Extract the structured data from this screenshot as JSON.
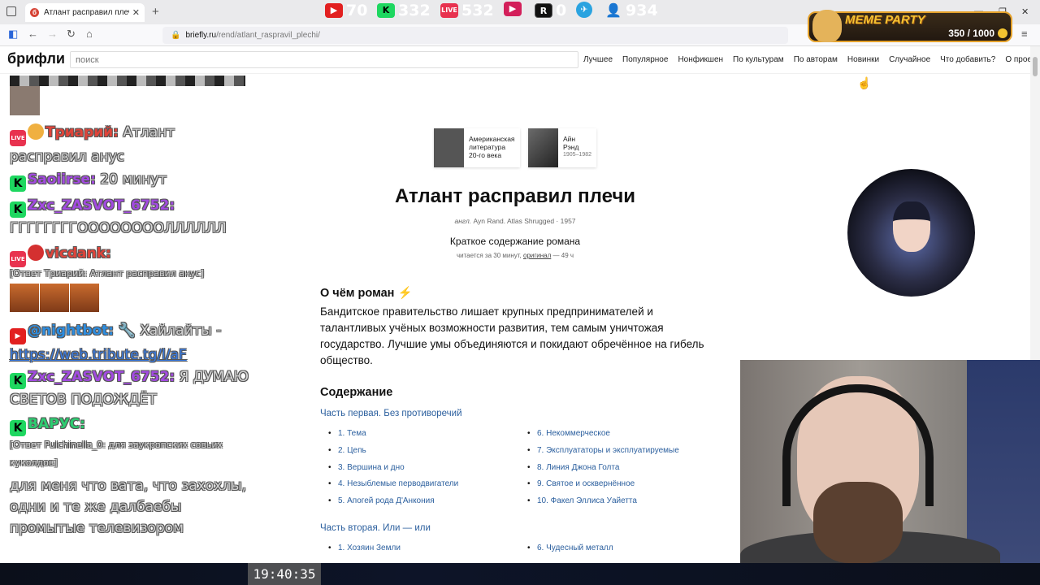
{
  "browser": {
    "tab_title": "Атлант расправил плечи · Кра",
    "tab_close": "✕",
    "new_tab": "+",
    "url_host": "briefly.ru",
    "url_path": "/rend/atlant_raspravil_plechi/",
    "win_min": "—",
    "win_max": "❐",
    "win_close": "✕",
    "back": "←",
    "forward": "→",
    "reload": "↻",
    "home": "⌂",
    "menu": "≡"
  },
  "meme_party": {
    "title": "MEME PARTY",
    "count": "350 / 1000"
  },
  "site": {
    "logo": "брифли",
    "search_placeholder": "поиск",
    "menu": [
      "Лучшее",
      "Популярное",
      "Нонфикшен",
      "По культурам",
      "По авторам",
      "Новинки",
      "Случайное",
      "Что добавить?",
      "О проекте"
    ]
  },
  "article": {
    "category1": "Американская литература 20-го века",
    "category1_lines": [
      "Американская",
      "литература",
      "20-го века"
    ],
    "author_lines": [
      "Айн",
      "Рэнд"
    ],
    "author_years": "1905–1982",
    "title": "Атлант расправил плечи",
    "orig_lang": "англ.",
    "orig_rest": "Ayn Rand. Atlas Shrugged · 1957",
    "subtitle": "Краткое содержание романа",
    "read_prefix": "читается за 30 минут,",
    "read_link": "оригинал",
    "read_suffix": "— 49 ч",
    "about_heading": "О чём роман ⚡",
    "about_text": "Бандитское правительство лишает крупных предпринимателей и талантливых учёных возможности развития, тем самым уничтожая государство. Лучшие умы объединяются и покидают обречённое на гибель общество.",
    "contents_heading": "Содержание",
    "part1": "Часть первая. Без противоречий",
    "part1_left": [
      "1. Тема",
      "2. Цепь",
      "3. Вершина и дно",
      "4. Незыблемые перводвигатели",
      "5. Апогей рода Д'Анкония"
    ],
    "part1_right": [
      "6. Некоммерческое",
      "7. Эксплуататоры и эксплуатируемые",
      "8. Линия Джона Голта",
      "9. Святое и осквернённое",
      "10. Факел Эллиса Уайетта"
    ],
    "part2": "Часть вторая. Или — или",
    "part2_left": [
      "1. Хозяин Земли"
    ],
    "part2_right": [
      "6. Чудесный металл"
    ]
  },
  "chat": {
    "m1_nick": "Триарий:",
    "m1_text": "Атлант расправил анус",
    "m2_nick": "Saoiirse:",
    "m2_text": "20 минут",
    "m3_nick": "Zxc_ZASVOT_6752:",
    "m3_text": "ГГГГГГГГООООООООЛЛЛЛЛЛ",
    "m4_nick": "vicdank:",
    "m4_reply": "[Ответ Триарий: Атлант расправил анус]",
    "m5_nick": "@nightbot:",
    "m5_text": "🔧 Хайлайты -",
    "m5_link": "https://web.tribute.tg/l/aF",
    "m6_nick": "Zxc_ZASVOT_6752:",
    "m6_text": "Я ДУМАЮ СВЕТОВ ПОДОЖДЁТ",
    "m7_nick": "ВАРУС:",
    "m7_reply": "[Ответ Pulchinella_0: для заукропских совьих куколдов]",
    "m7_text": "для меня что вата, что захохлы, одни и те же далбаебы промытые телевизором",
    "badge_live": "LIVE",
    "badge_k": "K",
    "badge_yt": "▶"
  },
  "status": {
    "time": "19:40:35",
    "youtube": "70",
    "kick": "332",
    "live": "532",
    "rutube": "0",
    "telegram": "",
    "viewers": "934"
  }
}
